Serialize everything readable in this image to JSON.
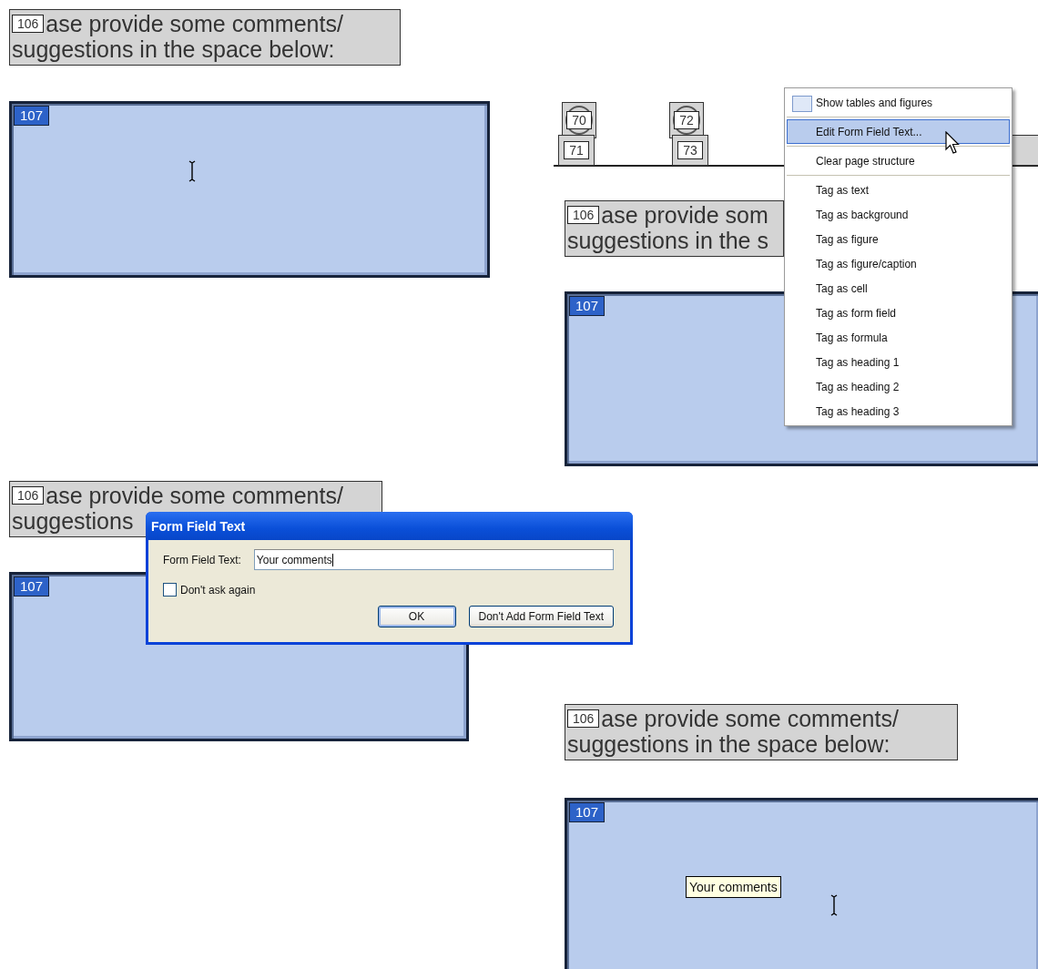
{
  "panels": [
    {
      "kind": "cursor",
      "heading": {
        "tag": "106",
        "lines": [
          "ase provide some comments/",
          "suggestions in the space below:"
        ]
      },
      "field": {
        "tag": "107"
      }
    },
    {
      "kind": "menu",
      "order_tags": [
        {
          "label": "70",
          "kind": "circle"
        },
        {
          "label": "71",
          "kind": "rect"
        },
        {
          "label": "72",
          "kind": "circle"
        },
        {
          "label": "73",
          "kind": "rect"
        }
      ],
      "heading": {
        "tag": "106",
        "lines": [
          "ase provide som",
          "suggestions in the s"
        ]
      },
      "field": {
        "tag": "107"
      },
      "context_menu": [
        {
          "kind": "check",
          "label": "Show tables and figures",
          "selected": false
        },
        {
          "kind": "separator"
        },
        {
          "kind": "item",
          "label": "Edit Form Field Text...",
          "selected": true
        },
        {
          "kind": "separator"
        },
        {
          "kind": "item",
          "label": "Clear page structure",
          "selected": false
        },
        {
          "kind": "separator"
        },
        {
          "kind": "item",
          "label": "Tag as text",
          "selected": false
        },
        {
          "kind": "item",
          "label": "Tag as background",
          "selected": false
        },
        {
          "kind": "item",
          "label": "Tag as figure",
          "selected": false
        },
        {
          "kind": "item",
          "label": "Tag as figure/caption",
          "selected": false
        },
        {
          "kind": "item",
          "label": "Tag as cell",
          "selected": false
        },
        {
          "kind": "item",
          "label": "Tag as form field",
          "selected": false
        },
        {
          "kind": "item",
          "label": "Tag as formula",
          "selected": false
        },
        {
          "kind": "item",
          "label": "Tag as heading 1",
          "selected": false
        },
        {
          "kind": "item",
          "label": "Tag as heading 2",
          "selected": false
        },
        {
          "kind": "item",
          "label": "Tag as heading 3",
          "selected": false
        }
      ]
    },
    {
      "kind": "dialog",
      "heading": {
        "tag": "106",
        "lines": [
          "ase provide some comments/",
          "suggestions"
        ]
      },
      "field": {
        "tag": "107"
      },
      "dialog": {
        "title": "Form Field Text",
        "label": "Form Field Text:",
        "value": "Your comments",
        "checkbox": {
          "label": "Don't ask again",
          "checked": false
        },
        "buttons": [
          {
            "label": "OK",
            "default": true
          },
          {
            "label": "Don't Add Form Field Text",
            "default": false
          }
        ]
      }
    },
    {
      "kind": "tooltip",
      "heading": {
        "tag": "106",
        "lines": [
          "ase provide some comments/",
          "suggestions in the space below:"
        ]
      },
      "field": {
        "tag": "107"
      },
      "tooltip": "Your comments"
    }
  ]
}
